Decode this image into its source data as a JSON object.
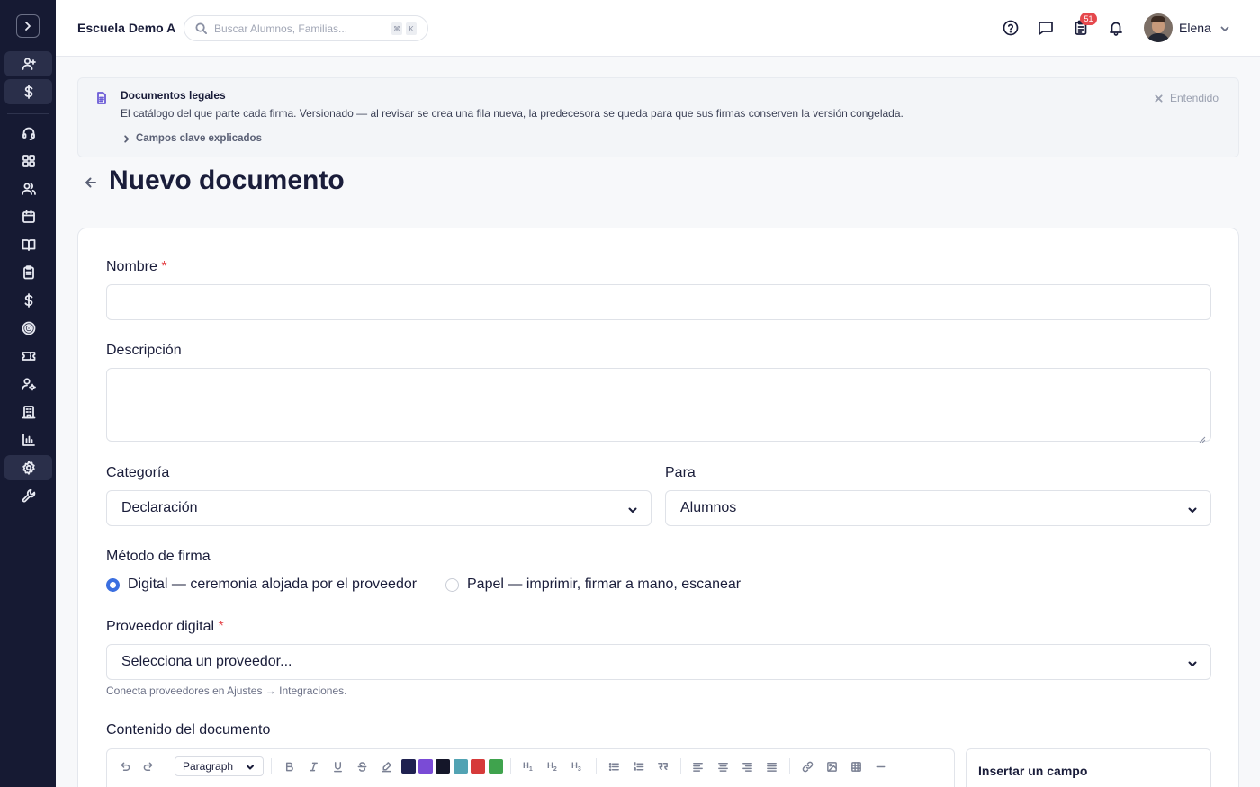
{
  "header": {
    "school_name": "Escuela Demo A",
    "search_placeholder": "Buscar Alumnos, Familias...",
    "shortcut_keys": [
      "⌘",
      "K"
    ],
    "tasks_badge": "51",
    "user_name": "Elena"
  },
  "sidebar": {
    "items": [
      {
        "icon": "user-plus-icon",
        "highlighted": true
      },
      {
        "icon": "dollar-icon",
        "highlighted": true
      },
      {
        "icon": "headset-icon",
        "highlighted": false
      },
      {
        "icon": "dashboard-grid-icon",
        "highlighted": false
      },
      {
        "icon": "users-icon",
        "highlighted": false
      },
      {
        "icon": "calendar-icon",
        "highlighted": false
      },
      {
        "icon": "book-open-icon",
        "highlighted": false
      },
      {
        "icon": "clipboard-icon",
        "highlighted": false
      },
      {
        "icon": "dollar-icon",
        "highlighted": false
      },
      {
        "icon": "target-icon",
        "highlighted": false
      },
      {
        "icon": "ticket-icon",
        "highlighted": false
      },
      {
        "icon": "user-cog-icon",
        "highlighted": false
      },
      {
        "icon": "building-icon",
        "highlighted": false
      },
      {
        "icon": "bar-chart-icon",
        "highlighted": false
      },
      {
        "icon": "settings-icon",
        "highlighted": true
      },
      {
        "icon": "wrench-icon",
        "highlighted": false
      }
    ]
  },
  "notice": {
    "title": "Documentos legales",
    "text": "El catálogo del que parte cada firma. Versionado — al revisar se crea una fila nueva, la predecesora se queda para que sus firmas conserven la versión congelada.",
    "expand_label": "Campos clave explicados",
    "dismiss_label": "Entendido"
  },
  "page": {
    "title": "Nuevo documento"
  },
  "form": {
    "name_label": "Nombre",
    "required_mark": "*",
    "name_value": "",
    "description_label": "Descripción",
    "description_value": "",
    "category_label": "Categoría",
    "category_value": "Declaración",
    "for_label": "Para",
    "for_value": "Alumnos",
    "signature_method_label": "Método de firma",
    "signature_options": [
      {
        "label": "Digital — ceremonia alojada por el proveedor",
        "selected": true
      },
      {
        "label": "Papel — imprimir, firmar a mano, escanear",
        "selected": false
      }
    ],
    "provider_label": "Proveedor digital",
    "provider_placeholder": "Selecciona un proveedor...",
    "provider_hint": "Conecta proveedores en Ajustes → Integraciones.",
    "content_label": "Contenido del documento"
  },
  "editor": {
    "block_type": "Paragraph",
    "heading_buttons": [
      {
        "letter": "H",
        "level": "1"
      },
      {
        "letter": "H",
        "level": "2"
      },
      {
        "letter": "H",
        "level": "3"
      }
    ],
    "colors": [
      "#1f2150",
      "#7a4bd6",
      "#141629",
      "#52a3b3",
      "#d63a3a",
      "#3fa34d"
    ]
  },
  "insert_field": {
    "title": "Insertar un campo"
  }
}
